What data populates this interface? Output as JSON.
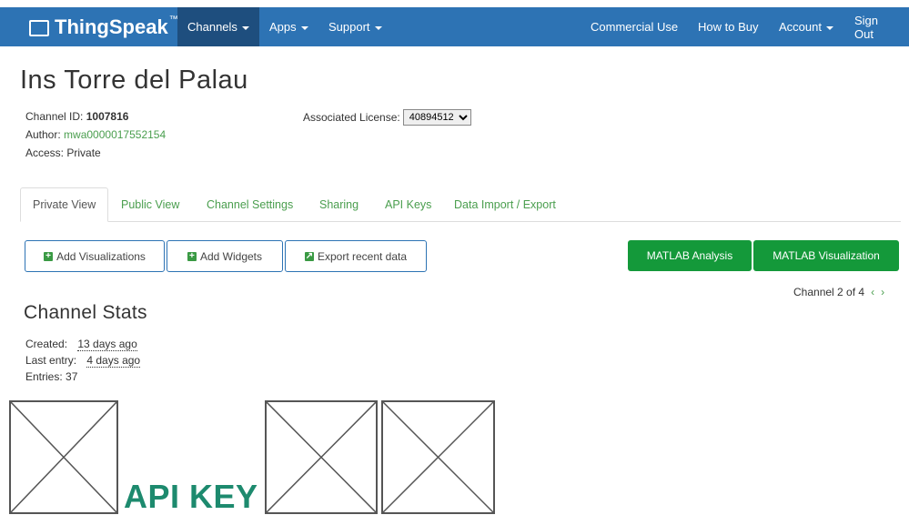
{
  "navbar": {
    "brand": "ThingSpeak",
    "brand_tm": "™",
    "items": [
      {
        "label": "Channels",
        "dropdown": true,
        "active": true
      },
      {
        "label": "Apps",
        "dropdown": true
      },
      {
        "label": "Support",
        "dropdown": true
      },
      {
        "label": "Commercial Use"
      },
      {
        "label": "How to Buy"
      },
      {
        "label": "Account",
        "dropdown": true
      },
      {
        "label": "Sign Out"
      }
    ]
  },
  "channel": {
    "title": "Ins Torre del Palau",
    "id_label": "Channel ID:",
    "id_value": "1007816",
    "author_label": "Author:",
    "author_value": "mwa0000017552154",
    "access_label": "Access:",
    "access_value": "Private",
    "license_label": "Associated License:",
    "license_value": "40894512"
  },
  "tabs": [
    {
      "label": "Private View",
      "active": true
    },
    {
      "label": "Public View"
    },
    {
      "label": "Channel Settings"
    },
    {
      "label": "Sharing"
    },
    {
      "label": "API Keys"
    },
    {
      "label": "Data Import / Export"
    }
  ],
  "buttons": {
    "add_visualizations": "Add Visualizations",
    "add_widgets": "Add Widgets",
    "export_recent": "Export recent data",
    "matlab_analysis": "MATLAB Analysis",
    "matlab_visualization": "MATLAB Visualization"
  },
  "pager": {
    "text": "Channel 2 of 4",
    "prev": "‹",
    "next": "›"
  },
  "stats": {
    "title": "Channel Stats",
    "created_label": "Created:",
    "created_value": "13 days ago",
    "last_entry_label": "Last entry:",
    "last_entry_value": "4 days ago",
    "entries_label": "Entries:",
    "entries_value": "37"
  },
  "footer_text": "API KEY",
  "colors": {
    "nav_bg": "#2d73b4",
    "nav_active": "#1e4e7e",
    "link_green": "#4a9e4e",
    "button_green": "#14993a",
    "api_key_text": "#1d8a6e"
  }
}
